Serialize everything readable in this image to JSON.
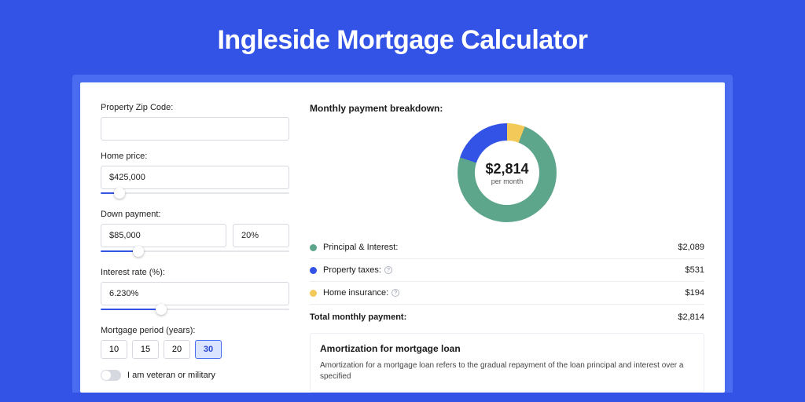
{
  "title": "Ingleside Mortgage Calculator",
  "form": {
    "zip_label": "Property Zip Code:",
    "zip_value": "",
    "home_price_label": "Home price:",
    "home_price_value": "$425,000",
    "home_price_slider_pct": 10,
    "down_payment_label": "Down payment:",
    "down_payment_value": "$85,000",
    "down_payment_pct_value": "20%",
    "down_payment_slider_pct": 20,
    "interest_label": "Interest rate (%):",
    "interest_value": "6.230%",
    "interest_slider_pct": 32,
    "period_label": "Mortgage period (years):",
    "periods": [
      "10",
      "15",
      "20",
      "30"
    ],
    "period_active_index": 3,
    "veteran_label": "I am veteran or military"
  },
  "breakdown": {
    "title": "Monthly payment breakdown:",
    "donut_amount": "$2,814",
    "donut_sub": "per month",
    "rows": [
      {
        "color": "#5da68b",
        "label": "Principal & Interest:",
        "value": "$2,089",
        "info": false
      },
      {
        "color": "#3353e6",
        "label": "Property taxes:",
        "value": "$531",
        "info": true
      },
      {
        "color": "#f3c95a",
        "label": "Home insurance:",
        "value": "$194",
        "info": true
      }
    ],
    "total_label": "Total monthly payment:",
    "total_value": "$2,814"
  },
  "amortization": {
    "title": "Amortization for mortgage loan",
    "text": "Amortization for a mortgage loan refers to the gradual repayment of the loan principal and interest over a specified"
  },
  "chart_data": {
    "type": "pie",
    "title": "Monthly payment breakdown",
    "series": [
      {
        "name": "Principal & Interest",
        "value": 2089,
        "color": "#5da68b"
      },
      {
        "name": "Property taxes",
        "value": 531,
        "color": "#3353e6"
      },
      {
        "name": "Home insurance",
        "value": 194,
        "color": "#f3c95a"
      }
    ],
    "total": 2814,
    "center_label": "$2,814 per month"
  }
}
